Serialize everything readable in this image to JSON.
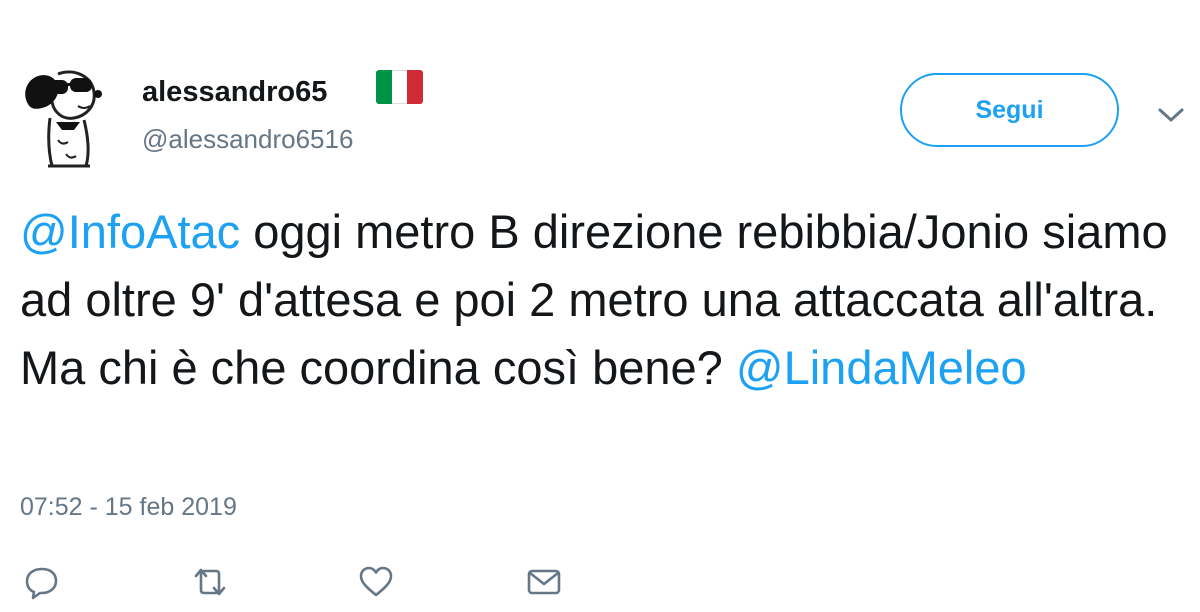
{
  "user": {
    "display_name": "alessandro65",
    "handle": "@alessandro6516",
    "avatar_icon": "snoopy-avatar-icon",
    "flag_icon": "italy-flag-icon",
    "flag_colors": [
      "#009246",
      "#ffffff",
      "#ce2b37"
    ]
  },
  "header": {
    "follow_label": "Segui",
    "menu_icon": "chevron-down-icon"
  },
  "tweet": {
    "mention_1": "@InfoAtac",
    "text": " oggi metro B direzione rebibbia/Jonio siamo ad oltre 9' d'attesa e poi 2 metro una attaccata all'altra. Ma chi è che coordina così bene? ",
    "mention_2": "@LindaMeleo",
    "timestamp": "07:52 - 15 feb 2019"
  },
  "actions": [
    {
      "name": "reply",
      "icon": "reply-icon"
    },
    {
      "name": "retweet",
      "icon": "retweet-icon"
    },
    {
      "name": "like",
      "icon": "heart-icon"
    },
    {
      "name": "direct-message",
      "icon": "envelope-icon"
    }
  ],
  "colors": {
    "accent": "#1da1f2",
    "text": "#14171a",
    "secondary": "#657786"
  }
}
